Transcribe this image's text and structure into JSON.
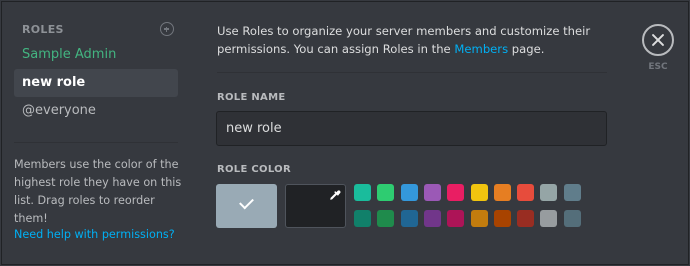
{
  "sidebar": {
    "title": "ROLES",
    "roles": [
      {
        "label": "Sample Admin",
        "color": "#43b581"
      },
      {
        "label": "new role",
        "selected": true
      },
      {
        "label": "@everyone"
      }
    ],
    "helper_text": "Members use the color of the highest role they have on this list. Drag roles to reorder them!",
    "help_link": "Need help with permissions?"
  },
  "main": {
    "intro_part1": "Use Roles to organize your server members and customize their permissions. You can assign Roles in the ",
    "intro_link": "Members",
    "intro_part2": " page.",
    "role_name_label": "ROLE NAME",
    "role_name_value": "new role",
    "role_color_label": "ROLE COLOR",
    "default_color": "#99aab5",
    "color_palette_top": [
      "#1abc9c",
      "#2ecc71",
      "#3498db",
      "#9b59b6",
      "#e91e63",
      "#f1c40f",
      "#e67e22",
      "#e74c3c",
      "#95a5a6",
      "#607d8b"
    ],
    "color_palette_bottom": [
      "#11806a",
      "#1f8b4c",
      "#206694",
      "#71368a",
      "#ad1457",
      "#c27c0e",
      "#a84300",
      "#992d22",
      "#979c9f",
      "#546e7a"
    ]
  },
  "close": {
    "label": "ESC"
  }
}
